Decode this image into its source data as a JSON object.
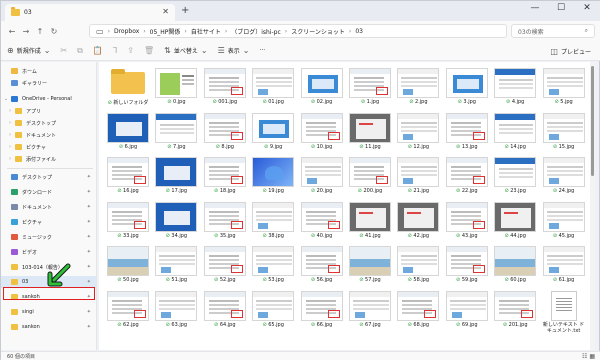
{
  "window": {
    "tab_title": "03",
    "tab_close": "✕",
    "new_tab": "+",
    "minimize": "—",
    "maximize": "☐",
    "close": "✕"
  },
  "address": {
    "segments": [
      "Dropbox",
      "05_HP関係",
      "自社サイト",
      "（ブログ）ishi-pc",
      "スクリーンショット",
      "03"
    ],
    "search_placeholder": "03の検索"
  },
  "commands": {
    "new": "新規作成",
    "sort": "並べ替え",
    "view": "表示",
    "more": "···",
    "preview": "プレビュー"
  },
  "sidebar": {
    "quick": [
      {
        "label": "ホーム",
        "color": "#f0b840"
      },
      {
        "label": "ギャラリー",
        "color": "#5a8fd6"
      }
    ],
    "onedrive": {
      "label": "OneDrive - Personal",
      "color": "#2a77d4"
    },
    "onedrive_children": [
      {
        "label": "アプリ",
        "color": "#f0c040"
      },
      {
        "label": "デスクトップ",
        "color": "#f0c040"
      },
      {
        "label": "ドキュメント",
        "color": "#f0c040"
      },
      {
        "label": "ピクチャ",
        "color": "#f0c040"
      },
      {
        "label": "添付ファイル",
        "color": "#f0c040"
      }
    ],
    "pinned": [
      {
        "label": "デスクトップ",
        "color": "#4a8ad4"
      },
      {
        "label": "ダウンロード",
        "color": "#2aa06a"
      },
      {
        "label": "ドキュメント",
        "color": "#7a8aa8"
      },
      {
        "label": "ピクチャ",
        "color": "#3aa0d8"
      },
      {
        "label": "ミュージック",
        "color": "#e05a40"
      },
      {
        "label": "ビデオ",
        "color": "#9a5ad6"
      },
      {
        "label": "103-014（報告）",
        "color": "#f0c040"
      },
      {
        "label": "03",
        "color": "#f0c040"
      },
      {
        "label": "sankoh",
        "color": "#f0c040"
      },
      {
        "label": "singi",
        "color": "#f0c040"
      },
      {
        "label": "sankon",
        "color": "#f0c040"
      }
    ]
  },
  "files": [
    {
      "name": "新しいフォルダ",
      "kind": "folder"
    },
    {
      "name": "0.jpg",
      "kind": "img1"
    },
    {
      "name": "001.jpg",
      "kind": "img2"
    },
    {
      "name": "01.jpg",
      "kind": "img3"
    },
    {
      "name": "02.jpg",
      "kind": "img4"
    },
    {
      "name": "1.jpg",
      "kind": "img2"
    },
    {
      "name": "2.jpg",
      "kind": "img3"
    },
    {
      "name": "3.jpg",
      "kind": "img4"
    },
    {
      "name": "4.jpg",
      "kind": "img5"
    },
    {
      "name": "5.jpg",
      "kind": "img3"
    },
    {
      "name": "6.jpg",
      "kind": "blue"
    },
    {
      "name": "7.jpg",
      "kind": "img5"
    },
    {
      "name": "8.jpg",
      "kind": "img2"
    },
    {
      "name": "9.jpg",
      "kind": "img4"
    },
    {
      "name": "10.jpg",
      "kind": "img2"
    },
    {
      "name": "11.jpg",
      "kind": "gray"
    },
    {
      "name": "12.jpg",
      "kind": "img3"
    },
    {
      "name": "13.jpg",
      "kind": "img2"
    },
    {
      "name": "14.jpg",
      "kind": "img5"
    },
    {
      "name": "15.jpg",
      "kind": "img3"
    },
    {
      "name": "16.jpg",
      "kind": "img2"
    },
    {
      "name": "17.jpg",
      "kind": "blue"
    },
    {
      "name": "18.jpg",
      "kind": "img2"
    },
    {
      "name": "19.jpg",
      "kind": "win11"
    },
    {
      "name": "20.jpg",
      "kind": "img3"
    },
    {
      "name": "200.jpg",
      "kind": "img2"
    },
    {
      "name": "21.jpg",
      "kind": "img3"
    },
    {
      "name": "22.jpg",
      "kind": "img2"
    },
    {
      "name": "23.jpg",
      "kind": "img5"
    },
    {
      "name": "24.jpg",
      "kind": "img3"
    },
    {
      "name": "33.jpg",
      "kind": "img2"
    },
    {
      "name": "34.jpg",
      "kind": "blue"
    },
    {
      "name": "35.jpg",
      "kind": "img2"
    },
    {
      "name": "38.jpg",
      "kind": "img3"
    },
    {
      "name": "40.jpg",
      "kind": "img2"
    },
    {
      "name": "41.jpg",
      "kind": "gray"
    },
    {
      "name": "42.jpg",
      "kind": "gray"
    },
    {
      "name": "43.jpg",
      "kind": "img2"
    },
    {
      "name": "44.jpg",
      "kind": "gray"
    },
    {
      "name": "45.jpg",
      "kind": "img3"
    },
    {
      "name": "50.jpg",
      "kind": "beach"
    },
    {
      "name": "51.jpg",
      "kind": "img3"
    },
    {
      "name": "52.jpg",
      "kind": "img2"
    },
    {
      "name": "53.jpg",
      "kind": "img3"
    },
    {
      "name": "56.jpg",
      "kind": "img2"
    },
    {
      "name": "57.jpg",
      "kind": "beach"
    },
    {
      "name": "58.jpg",
      "kind": "img3"
    },
    {
      "name": "59.jpg",
      "kind": "img2"
    },
    {
      "name": "60.jpg",
      "kind": "beach"
    },
    {
      "name": "61.jpg",
      "kind": "img3"
    },
    {
      "name": "62.jpg",
      "kind": "img2"
    },
    {
      "name": "63.jpg",
      "kind": "img3"
    },
    {
      "name": "64.jpg",
      "kind": "img2"
    },
    {
      "name": "65.jpg",
      "kind": "img3"
    },
    {
      "name": "66.jpg",
      "kind": "img2"
    },
    {
      "name": "67.jpg",
      "kind": "img3"
    },
    {
      "name": "68.jpg",
      "kind": "img2"
    },
    {
      "name": "69.jpg",
      "kind": "img3"
    },
    {
      "name": "201.jpg",
      "kind": "img2"
    },
    {
      "name": "新しいテキスト ドキュメント.txt",
      "kind": "txt"
    }
  ],
  "status": {
    "count": "60 個の項目"
  },
  "colors": {
    "selection_outline": "#e02020",
    "arrow": "#1fa02a",
    "check": "#2b9e3b"
  }
}
